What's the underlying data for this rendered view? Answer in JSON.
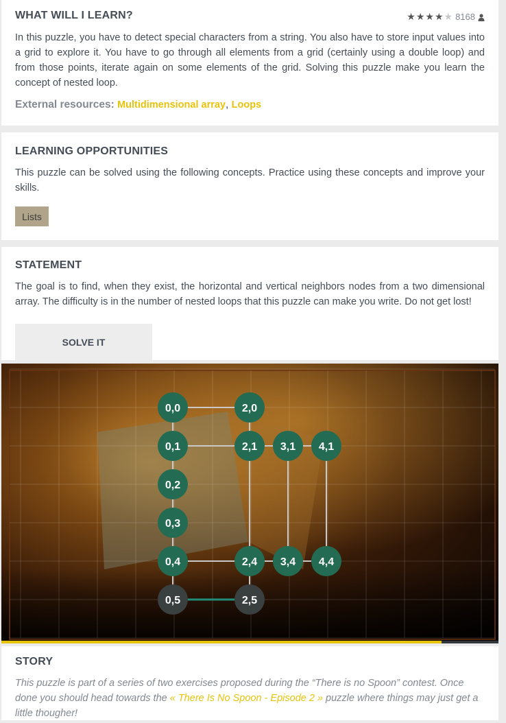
{
  "learn": {
    "title": "WHAT WILL I LEARN?",
    "rating_stars": 4,
    "rating_max": 5,
    "players_count": "8168",
    "description": "In this puzzle, you have to detect special characters from a string. You also have to store input values into a grid to explore it. You have to go through all elements from a grid (certainly using a double loop) and from those points, iterate again on some elements of the grid. Solving this puzzle make you learn the concept of nested loop.",
    "resources_label": "External resources:",
    "resources": [
      {
        "label": "Multidimensional array"
      },
      {
        "label": "Loops"
      }
    ],
    "resources_sep": ", "
  },
  "opportunities": {
    "title": "LEARNING OPPORTUNITIES",
    "description": "This puzzle can be solved using the following concepts. Practice using these concepts and improve your skills.",
    "tags": [
      "Lists"
    ]
  },
  "statement": {
    "title": "STATEMENT",
    "description": "The goal is to find, when they exist, the horizontal and vertical neighbors nodes from a two dimensional array. The difficulty is in the number of nested loops that this puzzle can make you write. Do not get lost!",
    "solve_label": "SOLVE IT"
  },
  "viewer": {
    "node_color": "#236b52",
    "node_inactive_color": "#3a3f40",
    "link_color": "#c9c9c9",
    "active_link_color": "#1f8f7a",
    "nodes": [
      {
        "label": "0,0",
        "col": 0,
        "row": 0,
        "active": true
      },
      {
        "label": "2,0",
        "col": 2,
        "row": 0,
        "active": true
      },
      {
        "label": "0,1",
        "col": 0,
        "row": 1,
        "active": true
      },
      {
        "label": "2,1",
        "col": 2,
        "row": 1,
        "active": true
      },
      {
        "label": "3,1",
        "col": 3,
        "row": 1,
        "active": true
      },
      {
        "label": "4,1",
        "col": 4,
        "row": 1,
        "active": true
      },
      {
        "label": "0,2",
        "col": 0,
        "row": 2,
        "active": true
      },
      {
        "label": "0,3",
        "col": 0,
        "row": 3,
        "active": true
      },
      {
        "label": "0,4",
        "col": 0,
        "row": 4,
        "active": true
      },
      {
        "label": "2,4",
        "col": 2,
        "row": 4,
        "active": true
      },
      {
        "label": "3,4",
        "col": 3,
        "row": 4,
        "active": true
      },
      {
        "label": "4,4",
        "col": 4,
        "row": 4,
        "active": true
      },
      {
        "label": "0,5",
        "col": 0,
        "row": 5,
        "active": false
      },
      {
        "label": "2,5",
        "col": 2,
        "row": 5,
        "active": false
      }
    ],
    "links": [
      [
        "0,0",
        "2,0"
      ],
      [
        "0,0",
        "0,1"
      ],
      [
        "2,0",
        "2,1"
      ],
      [
        "0,1",
        "2,1"
      ],
      [
        "2,1",
        "3,1"
      ],
      [
        "3,1",
        "4,1"
      ],
      [
        "0,1",
        "0,2"
      ],
      [
        "0,2",
        "0,3"
      ],
      [
        "0,3",
        "0,4"
      ],
      [
        "2,1",
        "2,4"
      ],
      [
        "3,1",
        "3,4"
      ],
      [
        "4,1",
        "4,4"
      ],
      [
        "0,4",
        "2,4"
      ],
      [
        "2,4",
        "3,4"
      ],
      [
        "3,4",
        "4,4"
      ],
      [
        "0,4",
        "0,5"
      ],
      [
        "2,4",
        "2,5"
      ]
    ],
    "active_link": [
      "0,5",
      "2,5"
    ],
    "progress": 0.885
  },
  "story": {
    "title": "STORY",
    "text_before": "This puzzle is part of a series of two exercises proposed during the “There is no Spoon” contest. Once done you should head towards the ",
    "link": "« There Is No Spoon - Episode 2 »",
    "text_after": " puzzle where things may just get a little thougher!"
  }
}
